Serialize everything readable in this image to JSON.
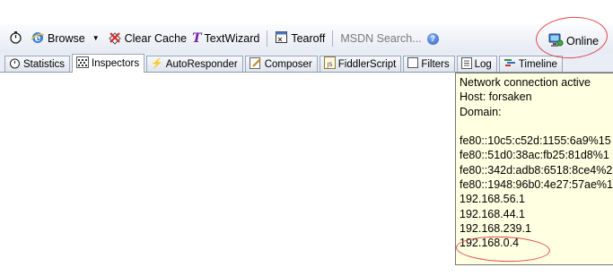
{
  "toolbar": {
    "browse_label": "Browse",
    "clear_cache_label": "Clear Cache",
    "textwizard_label": "TextWizard",
    "tearoff_label": "Tearoff",
    "msdn_search_label": "MSDN Search...",
    "online_label": "Online"
  },
  "tabs": [
    {
      "label": "Statistics",
      "active": false
    },
    {
      "label": "Inspectors",
      "active": true
    },
    {
      "label": "AutoResponder",
      "active": false
    },
    {
      "label": "Composer",
      "active": false
    },
    {
      "label": "FiddlerScript",
      "active": false
    },
    {
      "label": "Filters",
      "active": false
    },
    {
      "label": "Log",
      "active": false
    },
    {
      "label": "Timeline",
      "active": false
    }
  ],
  "tooltip": {
    "lines": [
      "Network connection active",
      "Host: forsaken",
      "Domain:",
      "",
      "fe80::10c5:c52d:1155:6a9%15",
      "fe80::51d0:38ac:fb25:81d8%1",
      "fe80::342d:adb8:6518:8ce4%2",
      "fe80::1948:96b0:4e27:57ae%1",
      "192.168.56.1",
      "192.168.44.1",
      "192.168.239.1",
      "192.168.0.4"
    ]
  },
  "colors": {
    "tooltip_background": "#ffffe1",
    "annotation_circle": "#e0474c",
    "toolbar_background": "#eef2f8"
  }
}
